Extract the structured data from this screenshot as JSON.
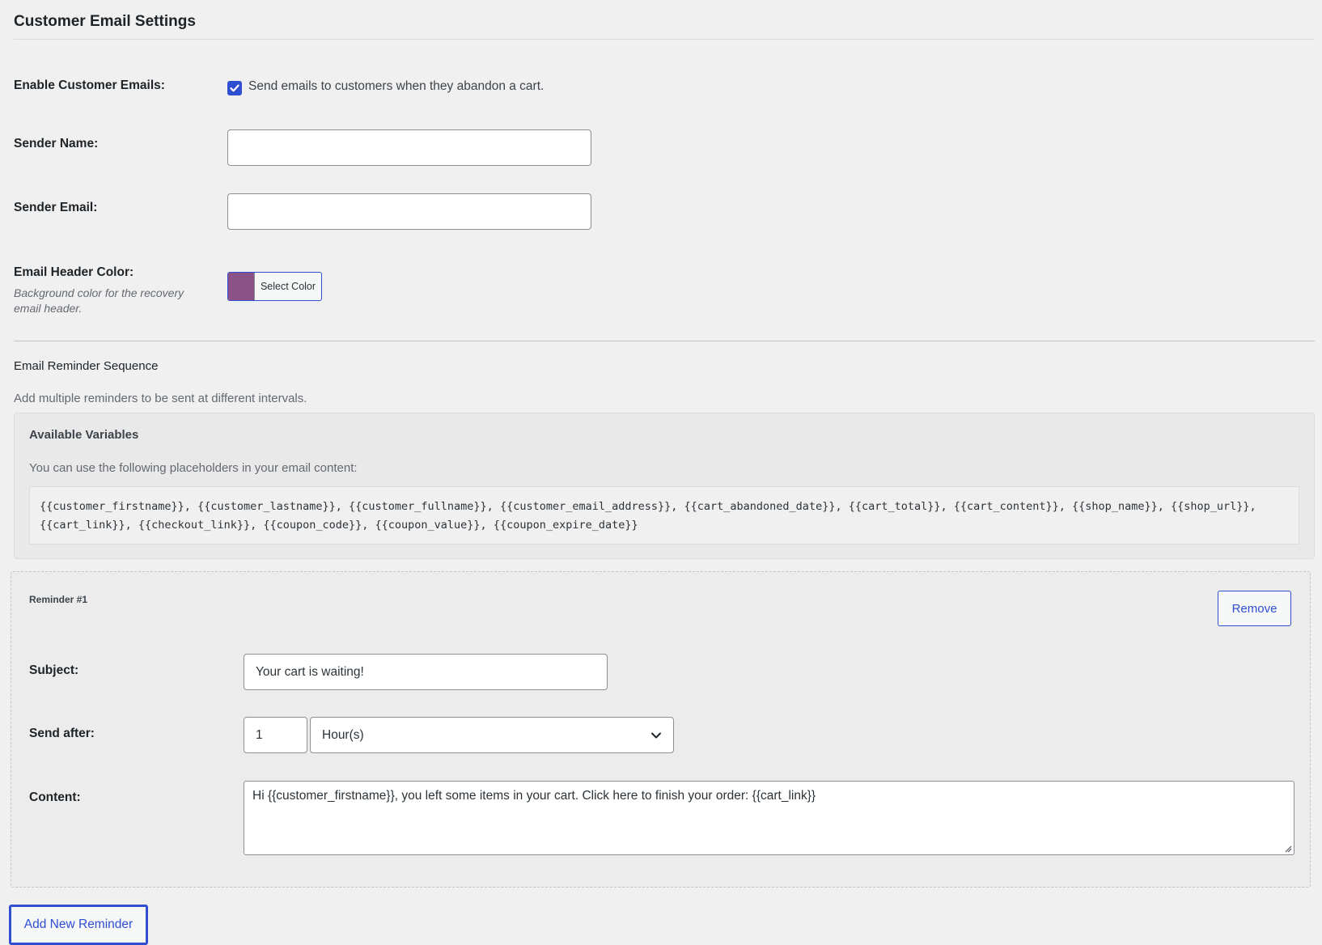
{
  "section": {
    "title": "Customer Email Settings"
  },
  "enable": {
    "label": "Enable Customer Emails:",
    "checkbox_label": "Send emails to customers when they abandon a cart.",
    "checked": true
  },
  "sender_name": {
    "label": "Sender Name:",
    "value": ""
  },
  "sender_email": {
    "label": "Sender Email:",
    "value": ""
  },
  "header_color": {
    "label": "Email Header Color:",
    "description": "Background color for the recovery email header.",
    "button_label": "Select Color",
    "swatch_color": "#8a5286"
  },
  "sequence": {
    "heading": "Email Reminder Sequence",
    "description": "Add multiple reminders to be sent at different intervals."
  },
  "variables": {
    "title": "Available Variables",
    "description": "You can use the following placeholders in your email content:",
    "line1": "{{customer_firstname}}, {{customer_lastname}}, {{customer_fullname}}, {{customer_email_address}}, {{cart_abandoned_date}}, {{cart_total}}, {{cart_content}}, {{shop_name}}, {{shop_url}},",
    "line2": "{{cart_link}}, {{checkout_link}}, {{coupon_code}}, {{coupon_value}}, {{coupon_expire_date}}"
  },
  "reminder": {
    "title": "Reminder #1",
    "remove_label": "Remove",
    "subject_label": "Subject:",
    "subject_value": "Your cart is waiting!",
    "send_after_label": "Send after:",
    "send_after_value": "1",
    "unit_value": "Hour(s)",
    "content_label": "Content:",
    "content_value": "Hi {{customer_firstname}}, you left some items in your cart. Click here to finish your order: {{cart_link}}"
  },
  "add_button_label": "Add New Reminder",
  "colors": {
    "accent": "#2f4ed1",
    "background": "#f0f0f1"
  }
}
